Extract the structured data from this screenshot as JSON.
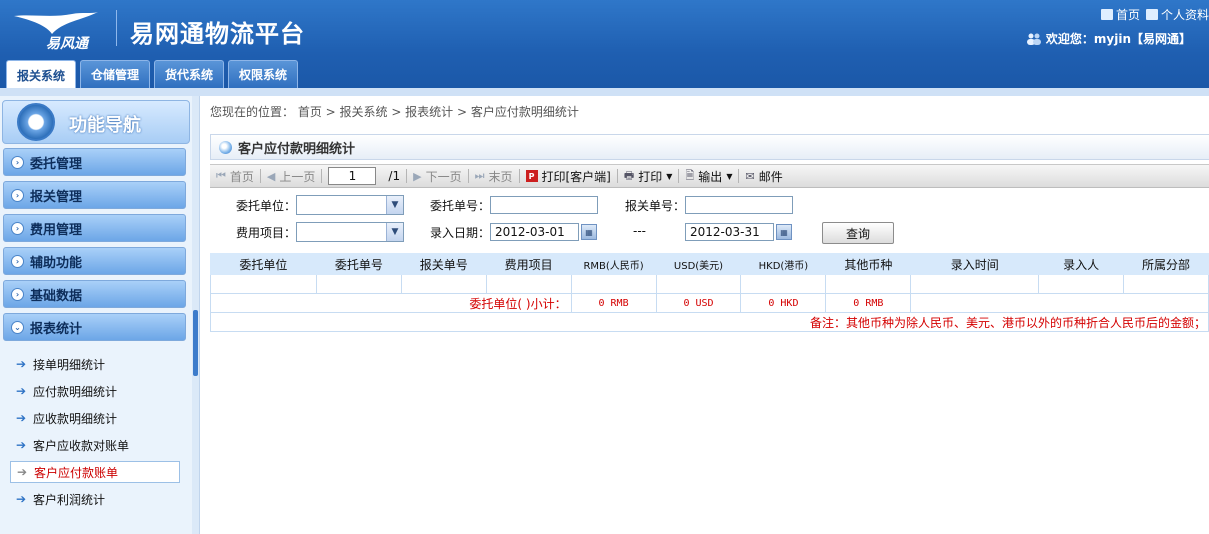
{
  "header": {
    "logo_text": "易风通",
    "platform_title": "易网通物流平台",
    "links": [
      "首页",
      "个人资料"
    ],
    "welcome": "欢迎您：myjin【易网通】"
  },
  "tabs": [
    {
      "label": "报关系统",
      "active": true
    },
    {
      "label": "仓储管理",
      "active": false
    },
    {
      "label": "货代系统",
      "active": false
    },
    {
      "label": "权限系统",
      "active": false
    }
  ],
  "sidebar": {
    "title": "功能导航",
    "menus": [
      "委托管理",
      "报关管理",
      "费用管理",
      "辅助功能",
      "基础数据",
      "报表统计"
    ],
    "expanded_menu": "报表统计",
    "sub_items": [
      {
        "label": "接单明细统计",
        "active": false
      },
      {
        "label": "应付款明细统计",
        "active": false
      },
      {
        "label": "应收款明细统计",
        "active": false
      },
      {
        "label": "客户应收款对账单",
        "active": false
      },
      {
        "label": "客户应付款账单",
        "active": true
      },
      {
        "label": "客户利润统计",
        "active": false
      }
    ]
  },
  "breadcrumb": "您现在的位置： 首页 > 报关系统 > 报表统计 > 客户应付款明细统计",
  "panel": {
    "title": "客户应付款明细统计"
  },
  "toolbar": {
    "first": "首页",
    "prev": "上一页",
    "page_value": "1",
    "page_total": "/1",
    "next": "下一页",
    "last": "末页",
    "print_client": "打印[客户端]",
    "print": "打印",
    "export": "输出",
    "mail": "邮件"
  },
  "filters": {
    "entrust_unit_label": "委托单位：",
    "entrust_no_label": "委托单号：",
    "customs_no_label": "报关单号：",
    "fee_item_label": "费用项目：",
    "entry_date_label": "录入日期：",
    "date_from": "2012-03-01",
    "date_sep": "---",
    "date_to": "2012-03-31",
    "query_button": "查询"
  },
  "table": {
    "headers": [
      "委托单位",
      "委托单号",
      "报关单号",
      "费用项目",
      "RMB(人民币)",
      "USD(美元)",
      "HKD(港币)",
      "其他币种",
      "录入时间",
      "录入人",
      "所属分部"
    ],
    "subtotal_label": "委托单位( )小计：",
    "subtotals": [
      "0 RMB",
      "0 USD",
      "0 HKD",
      "0 RMB"
    ],
    "note": "备注：其他币种为除人民币、美元、港币以外的币种折合人民币后的金额；"
  },
  "colors": {
    "header_blue": "#1f5fb1",
    "accent_red": "#d40000",
    "table_header_bg": "#d7e9fb"
  }
}
